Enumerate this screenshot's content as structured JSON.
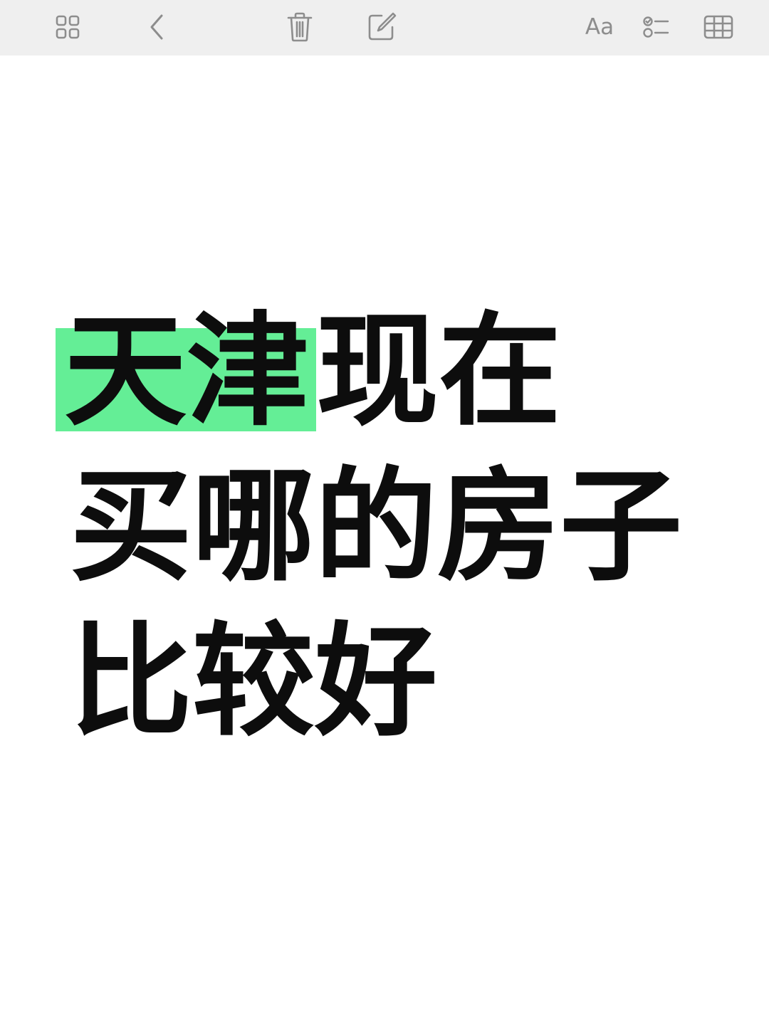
{
  "toolbar": {
    "left_icons": [
      "grid-icon",
      "chevron-left-icon",
      "trash-icon",
      "compose-icon"
    ],
    "right_icons": [
      "text-format-icon",
      "checklist-icon",
      "table-icon"
    ],
    "format_label": "Aa",
    "icon_color": "#8d8d8d",
    "background": "#efefef"
  },
  "note": {
    "lines": [
      {
        "highlight": "天津",
        "rest": "现在"
      },
      {
        "text": "买哪的房子"
      },
      {
        "text": "比较好"
      }
    ],
    "highlight_color": "#64ee96",
    "text_color": "#0d0d0d"
  }
}
